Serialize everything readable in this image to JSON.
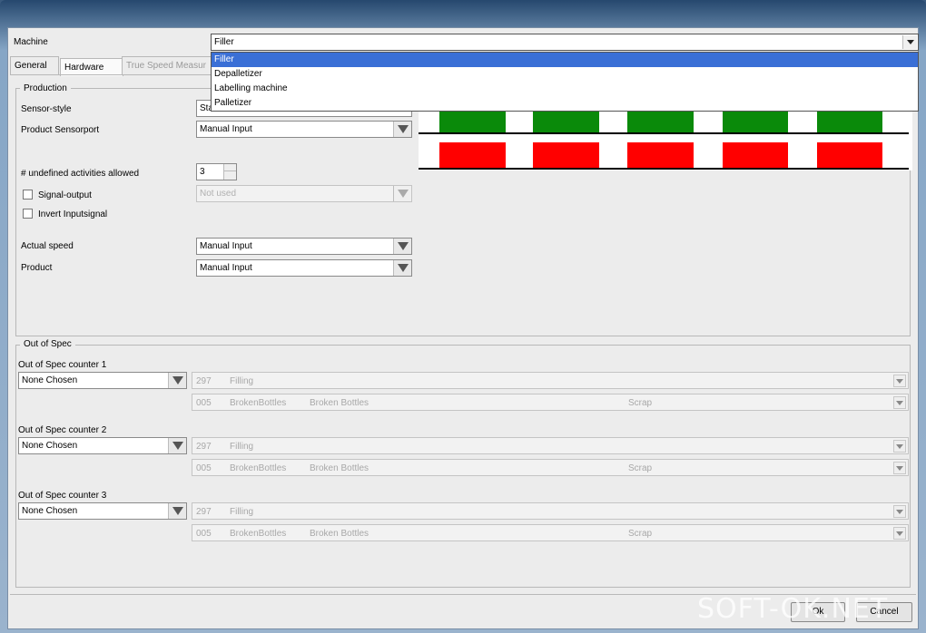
{
  "machine": {
    "label": "Machine",
    "value": "Filler"
  },
  "machine_dropdown": {
    "options": [
      "Filler",
      "Depalletizer",
      "Labelling machine",
      "Palletizer"
    ],
    "selected_index": 0
  },
  "tabs": [
    {
      "label": "General"
    },
    {
      "label": "Hardware"
    },
    {
      "label": "True Speed Measur"
    }
  ],
  "production": {
    "title": "Production",
    "sensor_style": {
      "label": "Sensor-style",
      "value": "Sta"
    },
    "product_sensorport": {
      "label": "Product Sensorport",
      "value": "Manual Input"
    },
    "undefined_activities": {
      "label": "# undefined activities allowed",
      "value": "3"
    },
    "signal_output": {
      "label": "Signal-output",
      "value": "Not used"
    },
    "invert_inputsignal": {
      "label": "Invert Inputsignal"
    },
    "actual_speed": {
      "label": "Actual speed",
      "value": "Manual Input"
    },
    "product": {
      "label": "Product",
      "value": "Manual Input"
    }
  },
  "signal_preview": {
    "colors": {
      "green": "#0a8a0a",
      "red": "#ff0000"
    }
  },
  "out_of_spec": {
    "title": "Out of Spec",
    "counters": [
      {
        "label": "Out of Spec counter 1",
        "value": "None Chosen",
        "row1": {
          "code": "297",
          "name": "Filling"
        },
        "row2": {
          "code": "005",
          "short": "BrokenBottles",
          "desc": "Broken Bottles",
          "category": "Scrap"
        }
      },
      {
        "label": "Out of Spec counter 2",
        "value": "None Chosen",
        "row1": {
          "code": "297",
          "name": "Filling"
        },
        "row2": {
          "code": "005",
          "short": "BrokenBottles",
          "desc": "Broken Bottles",
          "category": "Scrap"
        }
      },
      {
        "label": "Out of Spec counter 3",
        "value": "None Chosen",
        "row1": {
          "code": "297",
          "name": "Filling"
        },
        "row2": {
          "code": "005",
          "short": "BrokenBottles",
          "desc": "Broken Bottles",
          "category": "Scrap"
        }
      }
    ]
  },
  "buttons": {
    "ok": "Ok",
    "cancel": "Cancel"
  },
  "watermark": "SOFT-OK.NET"
}
